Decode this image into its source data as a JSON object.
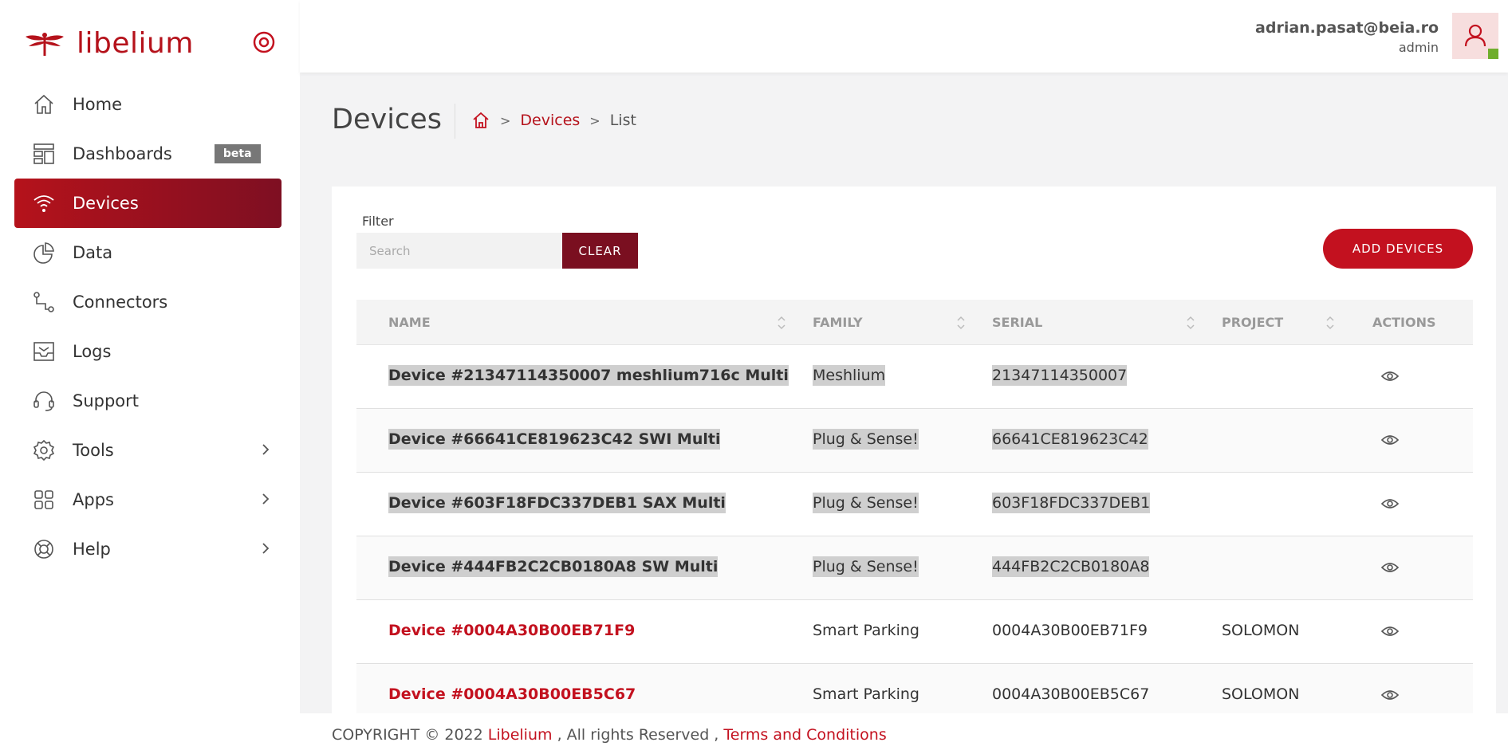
{
  "brand": {
    "name": "libelium"
  },
  "sidebar": {
    "items": [
      {
        "label": "Home",
        "icon": "home-icon"
      },
      {
        "label": "Dashboards",
        "icon": "dashboard-icon",
        "badge": "beta"
      },
      {
        "label": "Devices",
        "icon": "wifi-icon",
        "active": true
      },
      {
        "label": "Data",
        "icon": "pie-chart-icon"
      },
      {
        "label": "Connectors",
        "icon": "connector-icon"
      },
      {
        "label": "Logs",
        "icon": "inbox-icon"
      },
      {
        "label": "Support",
        "icon": "headset-icon"
      },
      {
        "label": "Tools",
        "icon": "gear-icon",
        "expandable": true
      },
      {
        "label": "Apps",
        "icon": "apps-icon",
        "expandable": true
      },
      {
        "label": "Help",
        "icon": "lifebuoy-icon",
        "expandable": true
      }
    ]
  },
  "header": {
    "email": "adrian.pasat@beia.ro",
    "role": "admin"
  },
  "page": {
    "title": "Devices",
    "breadcrumb": {
      "link": "Devices",
      "current": "List"
    }
  },
  "filter": {
    "label": "Filter",
    "placeholder": "Search",
    "clear_label": "CLEAR"
  },
  "add_devices_label": "ADD DEVICES",
  "table": {
    "columns": [
      "NAME",
      "FAMILY",
      "SERIAL",
      "PROJECT",
      "ACTIONS"
    ],
    "rows": [
      {
        "name": "Device #21347114350007 meshlium716c Multi",
        "family": "Meshlium",
        "serial": "21347114350007",
        "project": "",
        "highlighted": true
      },
      {
        "name": "Device #66641CE819623C42 SWI Multi",
        "family": "Plug & Sense!",
        "serial": "66641CE819623C42",
        "project": "",
        "highlighted": true
      },
      {
        "name": "Device #603F18FDC337DEB1 SAX Multi",
        "family": "Plug & Sense!",
        "serial": "603F18FDC337DEB1",
        "project": "",
        "highlighted": true
      },
      {
        "name": "Device #444FB2C2CB0180A8 SW Multi",
        "family": "Plug & Sense!",
        "serial": "444FB2C2CB0180A8",
        "project": "",
        "highlighted": true
      },
      {
        "name": "Device #0004A30B00EB71F9",
        "family": "Smart Parking",
        "serial": "0004A30B00EB71F9",
        "project": "SOLOMON",
        "highlighted": false
      },
      {
        "name": "Device #0004A30B00EB5C67",
        "family": "Smart Parking",
        "serial": "0004A30B00EB5C67",
        "project": "SOLOMON",
        "highlighted": false
      }
    ]
  },
  "footer": {
    "copyright": "COPYRIGHT © 2022",
    "brand_link": "Libelium",
    "rights": ", All rights Reserved ,",
    "terms_link": "Terms and Conditions"
  },
  "colors": {
    "accent": "#c3111f",
    "accent_dark": "#7a0f20",
    "status_online": "#6fae2c"
  }
}
